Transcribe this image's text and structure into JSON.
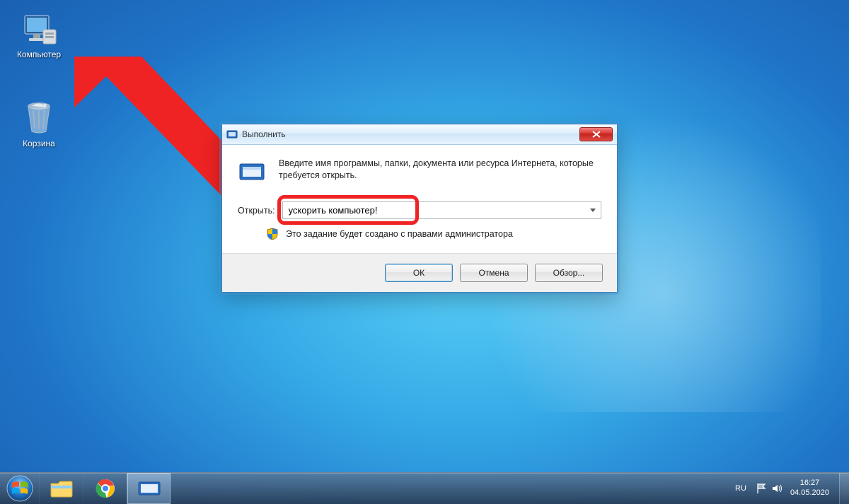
{
  "desktop": {
    "icons": {
      "computer": "Компьютер",
      "recycle": "Корзина"
    }
  },
  "run_dialog": {
    "title": "Выполнить",
    "description": "Введите имя программы, папки, документа или ресурса Интернета, которые требуется открыть.",
    "open_label": "Открыть:",
    "input_value": "ускорить компьютер!",
    "admin_note": "Это задание будет создано с правами администратора",
    "buttons": {
      "ok": "ОК",
      "cancel": "Отмена",
      "browse": "Обзор..."
    }
  },
  "taskbar": {
    "lang": "RU",
    "time": "16:27",
    "date": "04.05.2020"
  },
  "colors": {
    "arrow": "#ef2323",
    "highlight": "#ef2323",
    "close_btn": "#c9302c"
  }
}
